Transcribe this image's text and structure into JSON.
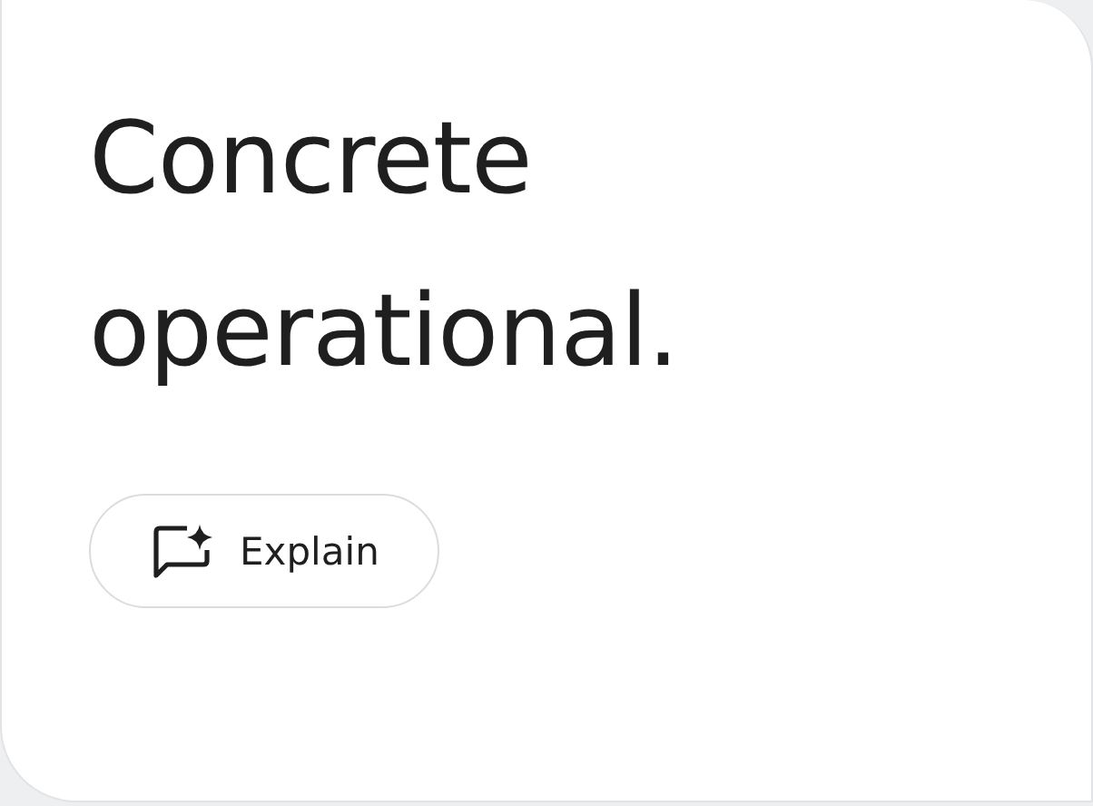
{
  "answer": {
    "text": "Concrete operational."
  },
  "buttons": [
    {
      "label": "Explain"
    }
  ]
}
